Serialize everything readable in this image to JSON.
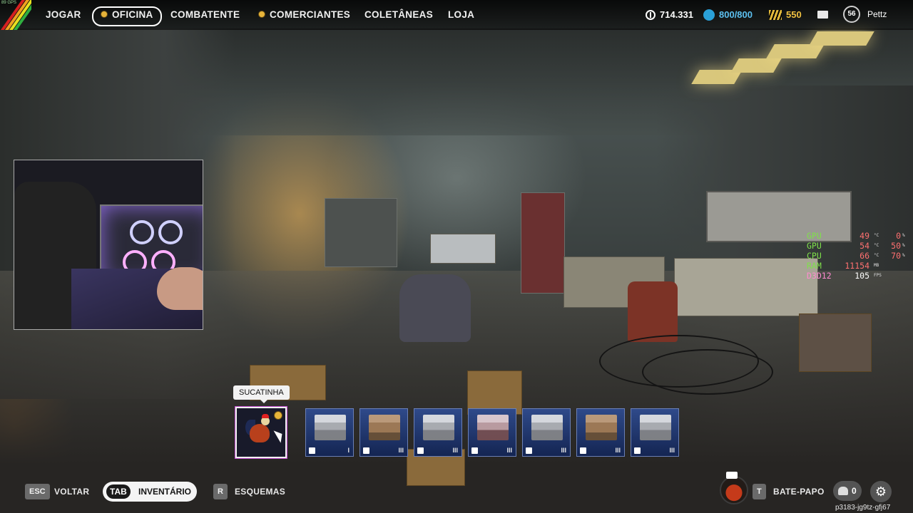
{
  "overlay": {
    "fps_tag": "89 GPS"
  },
  "nav": {
    "items": [
      {
        "label": "JOGAR",
        "dot": false,
        "active": false
      },
      {
        "label": "OFICINA",
        "dot": true,
        "active": true
      },
      {
        "label": "COMBATENTE",
        "dot": false,
        "active": false
      },
      {
        "label": "COMERCIANTES",
        "dot": true,
        "active": false
      },
      {
        "label": "COLETÂNEAS",
        "dot": false,
        "active": false
      },
      {
        "label": "LOJA",
        "dot": false,
        "active": false
      }
    ]
  },
  "currency": {
    "coins": "714.331",
    "caps": "800/800",
    "scrap": "550"
  },
  "profile": {
    "level": "56",
    "name": "Pettz"
  },
  "hwmon": {
    "rows": [
      {
        "name": "GPU",
        "v1": "49",
        "u1": "°C",
        "v2": "0",
        "u2": "%"
      },
      {
        "name": "GPU",
        "v1": "54",
        "u1": "°C",
        "v2": "50",
        "u2": "%"
      },
      {
        "name": "CPU",
        "v1": "66",
        "u1": "°C",
        "v2": "70",
        "u2": "%"
      },
      {
        "name": "RAM",
        "v1": "11154",
        "u1": "MB",
        "v2": "",
        "u2": ""
      },
      {
        "name": "D3D12",
        "v1": "105",
        "u1": "FPS",
        "v2": "",
        "u2": ""
      }
    ]
  },
  "workshop": {
    "tooltip": "SUCATINHA",
    "slots": [
      {
        "name": "Sucatinha",
        "tier": "",
        "selected": true
      },
      {
        "name": "bench-1",
        "tier": "I"
      },
      {
        "name": "bench-2",
        "tier": "III"
      },
      {
        "name": "bench-3",
        "tier": "III"
      },
      {
        "name": "bench-4",
        "tier": "III"
      },
      {
        "name": "bench-5",
        "tier": "III"
      },
      {
        "name": "bench-6",
        "tier": "III"
      },
      {
        "name": "bench-7",
        "tier": "III"
      }
    ]
  },
  "bottom": {
    "esc_key": "ESC",
    "esc_label": "VOLTAR",
    "tab_key": "TAB",
    "tab_label": "INVENTÁRIO",
    "r_key": "R",
    "r_label": "ESQUEMAS",
    "t_key": "T",
    "t_label": "BATE-PAPO",
    "friends_count": "0",
    "session_id": "p3183-jg9tz-gfj67"
  },
  "colors": {
    "accent_gold": "#e7b43a",
    "caps_blue": "#2aa0d8",
    "hw_green": "#7fe04a",
    "hw_red": "#ff7070"
  }
}
